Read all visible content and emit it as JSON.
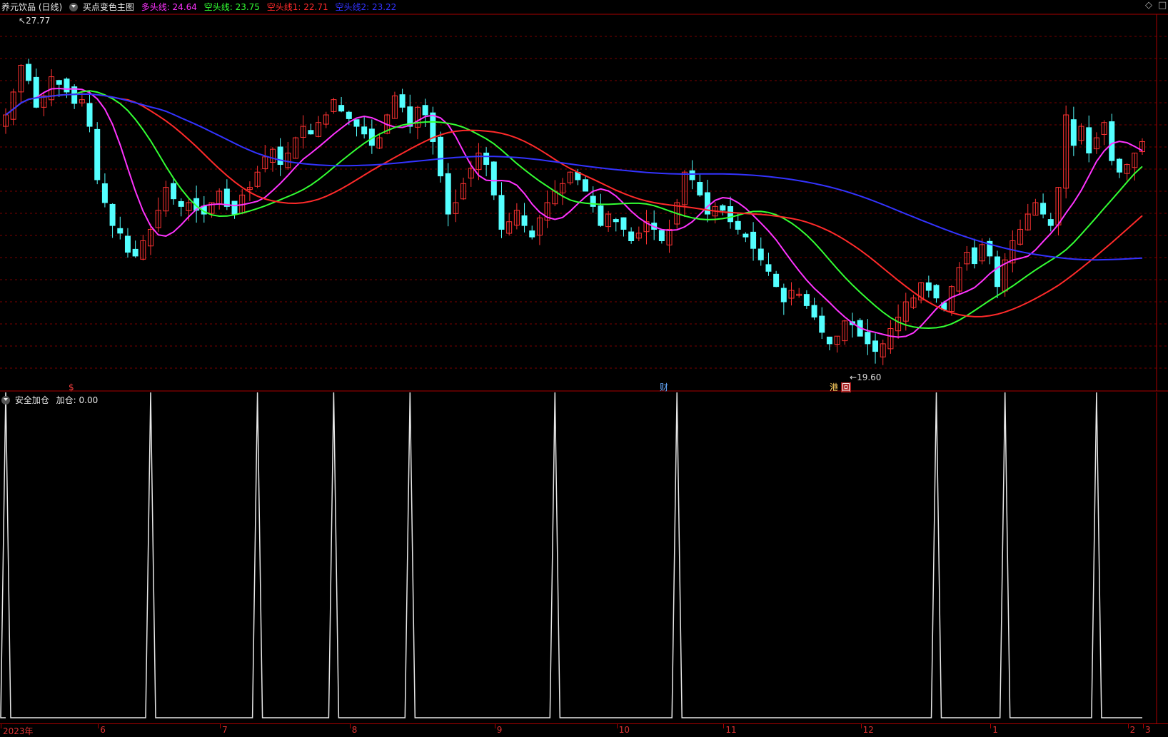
{
  "main_header": {
    "title": "养元饮品 (日线)",
    "indicator_name": "买点变色主图",
    "indicators": [
      {
        "label": "多头线: 24.64",
        "color": "#ff33ff"
      },
      {
        "label": "空头线: 23.75",
        "color": "#33ff33"
      },
      {
        "label": "空头线1: 22.71",
        "color": "#ff2a2a"
      },
      {
        "label": "空头线2: 23.22",
        "color": "#3333ff"
      }
    ]
  },
  "sub_header": {
    "title": "安全加仓",
    "value_label": "加仓: 0.00"
  },
  "markers": {
    "high": "27.77",
    "low": "19.60",
    "event_s": "$",
    "event_cai": "财",
    "event_gang": "港",
    "event_hui": "回"
  },
  "date_axis": [
    "2023年",
    "6",
    "7",
    "8",
    "9",
    "10",
    "11",
    "12",
    "1",
    "2",
    "3"
  ],
  "colors": {
    "up": "#ff3232",
    "down": "#54ffff",
    "grid": "#7a0000",
    "border": "#aa0000"
  },
  "chart_data": [
    {
      "type": "candlestick",
      "title": "养元饮品 (日线)",
      "ylim": [
        19.0,
        28.5
      ],
      "high": 27.77,
      "low": 19.6,
      "series_lines": [
        {
          "name": "多头线",
          "last": 24.64,
          "color": "#ff33ff"
        },
        {
          "name": "空头线",
          "last": 23.75,
          "color": "#33ff33"
        },
        {
          "name": "空头线1",
          "last": 22.71,
          "color": "#ff2a2a"
        },
        {
          "name": "空头线2",
          "last": 23.22,
          "color": "#3333ff"
        }
      ],
      "close_series": [
        25.9,
        26.5,
        27.2,
        26.8,
        26.1,
        26.4,
        26.9,
        26.7,
        26.5,
        26.2,
        26.3,
        25.6,
        24.2,
        23.6,
        23.0,
        22.8,
        22.3,
        22.2,
        22.6,
        22.9,
        23.4,
        24.0,
        23.7,
        23.5,
        23.6,
        23.4,
        23.3,
        23.6,
        23.9,
        23.5,
        23.3,
        23.8,
        24.0,
        24.4,
        24.8,
        25.0,
        24.6,
        24.9,
        25.3,
        25.6,
        25.4,
        25.7,
        25.9,
        26.3,
        26.0,
        25.8,
        25.6,
        25.4,
        25.1,
        25.3,
        25.9,
        26.4,
        26.1,
        25.6,
        26.1,
        25.9,
        25.2,
        24.3,
        23.3,
        23.6,
        24.1,
        24.5,
        24.9,
        24.6,
        23.8,
        22.9,
        23.1,
        23.4,
        23.0,
        22.7,
        23.2,
        23.6,
        23.9,
        24.1,
        24.4,
        24.2,
        23.9,
        23.5,
        23.0,
        23.3,
        23.1,
        22.9,
        22.6,
        22.8,
        23.1,
        22.9,
        22.6,
        22.9,
        23.6,
        24.4,
        24.2,
        23.8,
        23.3,
        23.5,
        23.4,
        23.1,
        22.9,
        22.7,
        22.4,
        22.1,
        21.8,
        21.4,
        21.0,
        21.3,
        21.2,
        20.9,
        20.6,
        20.2,
        19.9,
        20.1,
        20.5,
        20.4,
        20.1,
        19.9,
        19.7,
        19.9,
        20.3,
        20.6,
        21.0,
        21.1,
        21.5,
        21.3,
        21.1,
        20.8,
        21.4,
        21.9,
        22.3,
        22.0,
        22.5,
        22.2,
        21.4,
        22.1,
        22.6,
        22.9,
        23.3,
        23.6,
        23.3,
        23.0,
        24.0,
        25.9,
        25.1,
        25.6,
        24.9,
        25.3,
        25.7,
        24.7,
        24.4,
        24.6,
        24.9,
        25.2
      ],
      "x_ticks": [
        "2023年",
        "6",
        "7",
        "8",
        "9",
        "10",
        "11",
        "12",
        "1",
        "2",
        "3"
      ]
    },
    {
      "type": "line",
      "title": "安全加仓",
      "ylim": [
        0,
        1
      ],
      "series": [
        {
          "name": "加仓",
          "last": 0.0
        }
      ],
      "spike_indices": [
        0,
        19,
        33,
        43,
        53,
        72,
        88,
        122,
        131,
        143
      ]
    }
  ]
}
